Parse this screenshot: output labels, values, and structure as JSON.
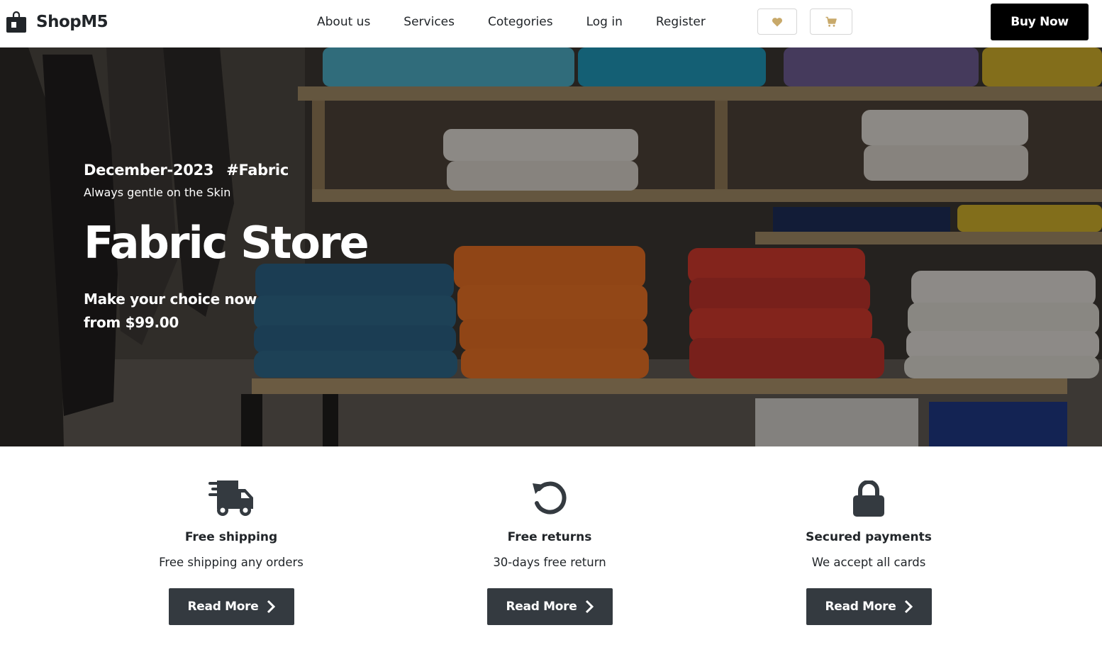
{
  "header": {
    "brand": "ShopM5",
    "brand_icon": "shopping-bag-icon",
    "nav": [
      "About us",
      "Services",
      "Cotegories",
      "Log in",
      "Register"
    ],
    "wishlist_icon": "heart-icon",
    "cart_icon": "cart-icon",
    "icon_color": "#c8a96a",
    "buy_label": "Buy Now"
  },
  "hero": {
    "date": "December-2023",
    "tag": "#Fabric",
    "subtitle": "Always gentle on the Skin",
    "title": "Fabric Store",
    "choice_line1": "Make your choice now",
    "choice_line2": "from $99.00"
  },
  "features": [
    {
      "icon": "truck-icon",
      "title": "Free shipping",
      "desc": "Free shipping any orders",
      "button": "Read More"
    },
    {
      "icon": "rotate-icon",
      "title": "Free returns",
      "desc": "30-days free return",
      "button": "Read More"
    },
    {
      "icon": "lock-icon",
      "title": "Secured payments",
      "desc": "We accept all cards",
      "button": "Read More"
    }
  ],
  "colors": {
    "button_dark": "#343a40",
    "buy_button": "#000000",
    "text": "#212529"
  }
}
